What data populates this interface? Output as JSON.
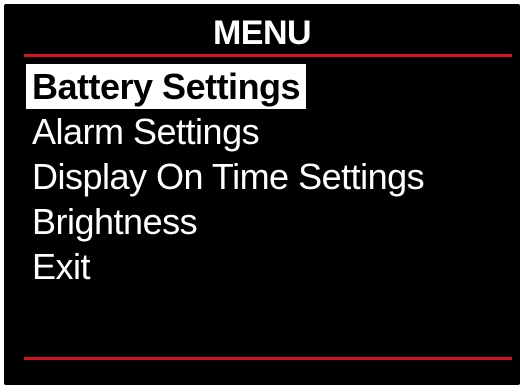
{
  "menu": {
    "title": "MENU",
    "selected_index": 0,
    "items": [
      {
        "label": "Battery Settings"
      },
      {
        "label": "Alarm Settings"
      },
      {
        "label": "Display On Time Settings"
      },
      {
        "label": "Brightness"
      },
      {
        "label": "Exit"
      }
    ]
  },
  "colors": {
    "background": "#000000",
    "text": "#ffffff",
    "accent_rule": "#d3121f",
    "selected_background": "#ffffff",
    "selected_text": "#000000"
  }
}
